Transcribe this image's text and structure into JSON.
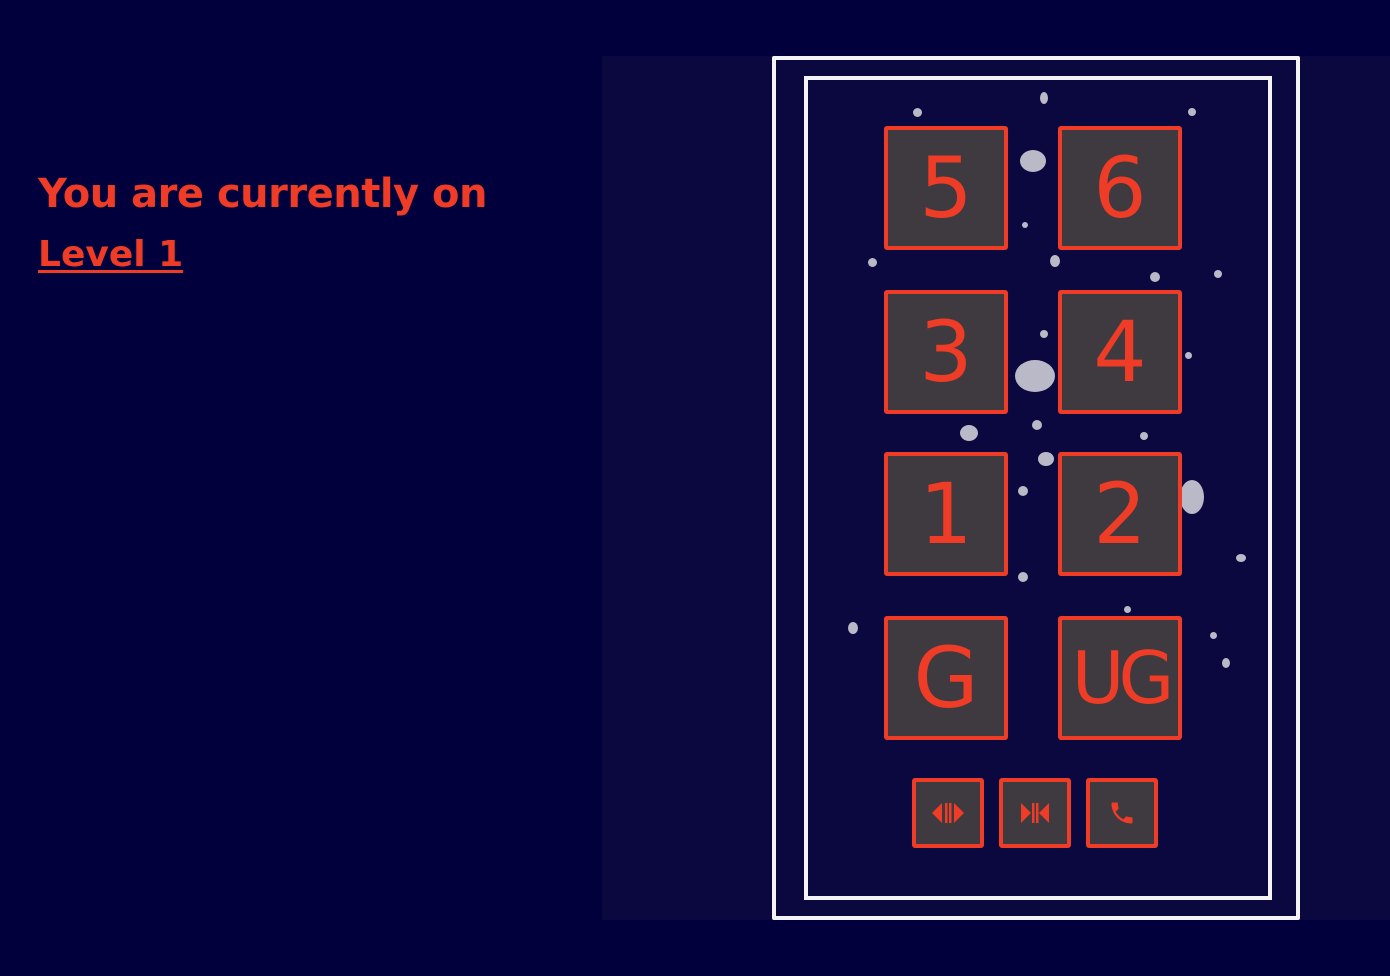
{
  "status": {
    "prefix": "You are currently on",
    "level": "Level 1"
  },
  "elevator": {
    "floors": [
      "5",
      "6",
      "3",
      "4",
      "1",
      "2",
      "G",
      "UG"
    ],
    "controls": [
      {
        "icon": "open-doors-icon"
      },
      {
        "icon": "close-doors-icon"
      },
      {
        "icon": "phone-icon"
      }
    ]
  },
  "colors": {
    "background": "#02003c",
    "panel": "#0b0840",
    "accent": "#ee3c26",
    "button_face": "#3e3a3f",
    "frame": "#f4f4f4"
  }
}
